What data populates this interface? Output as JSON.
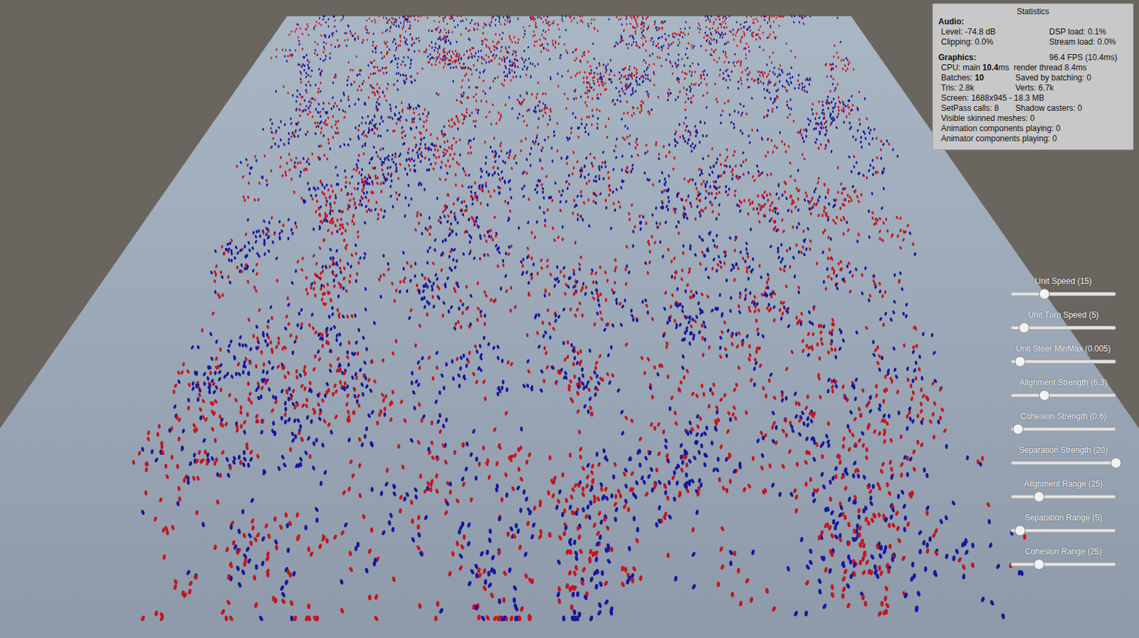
{
  "statistics": {
    "title": "Statistics",
    "audio": {
      "heading": "Audio:",
      "rows": [
        [
          "Level: -74.8 dB",
          "DSP load: 0.1%"
        ],
        [
          "Clipping: 0.0%",
          "Stream load: 0.0%"
        ]
      ]
    },
    "graphics": {
      "heading": "Graphics:",
      "fps": "96.4 FPS (10.4ms)",
      "rows": [
        {
          "cells": [
            [
              {
                "text": "CPU: main ",
                "bold": false
              },
              {
                "text": "10.4",
                "bold": true
              },
              {
                "text": "ms  render thread 8.4ms",
                "bold": false
              }
            ]
          ]
        },
        {
          "cells": [
            [
              {
                "text": "Batches: ",
                "bold": false
              },
              {
                "text": "10",
                "bold": true
              }
            ],
            [
              {
                "text": "Saved by batching: 0",
                "bold": false
              }
            ]
          ]
        },
        {
          "cells": [
            [
              {
                "text": "Tris: 2.8k",
                "bold": false
              }
            ],
            [
              {
                "text": "Verts: 6.7k",
                "bold": false
              }
            ]
          ]
        },
        {
          "cells": [
            [
              {
                "text": "Screen: 1688x945 - 18.3 MB",
                "bold": false
              }
            ]
          ]
        },
        {
          "cells": [
            [
              {
                "text": "SetPass calls: 8",
                "bold": false
              }
            ],
            [
              {
                "text": "Shadow casters: 0",
                "bold": false
              }
            ]
          ]
        },
        {
          "cells": [
            [
              {
                "text": "Visible skinned meshes: 0",
                "bold": false
              }
            ]
          ]
        },
        {
          "cells": [
            [
              {
                "text": "Animation components playing: 0",
                "bold": false
              }
            ]
          ]
        },
        {
          "cells": [
            [
              {
                "text": "Animator components playing: 0",
                "bold": false
              }
            ]
          ]
        }
      ]
    }
  },
  "sliders": [
    {
      "label": "Unit Speed (15)",
      "level": 0.32
    },
    {
      "label": "Unit Turn Speed (5)",
      "level": 0.13
    },
    {
      "label": "Unit Steer MinMax (0.005)",
      "level": 0.09
    },
    {
      "label": "Alignment Strength (6.3)",
      "level": 0.32
    },
    {
      "label": "Cohesion Strength (0.6)",
      "level": 0.07
    },
    {
      "label": "Separation Strength (20)",
      "level": 1.0
    },
    {
      "label": "Alignment Range (25)",
      "level": 0.27
    },
    {
      "label": "Separation Range (5)",
      "level": 0.09
    },
    {
      "label": "Cohesion Range (25)",
      "level": 0.27
    }
  ],
  "teams": [
    {
      "color": "#c4161f"
    },
    {
      "color": "#17179c"
    }
  ]
}
